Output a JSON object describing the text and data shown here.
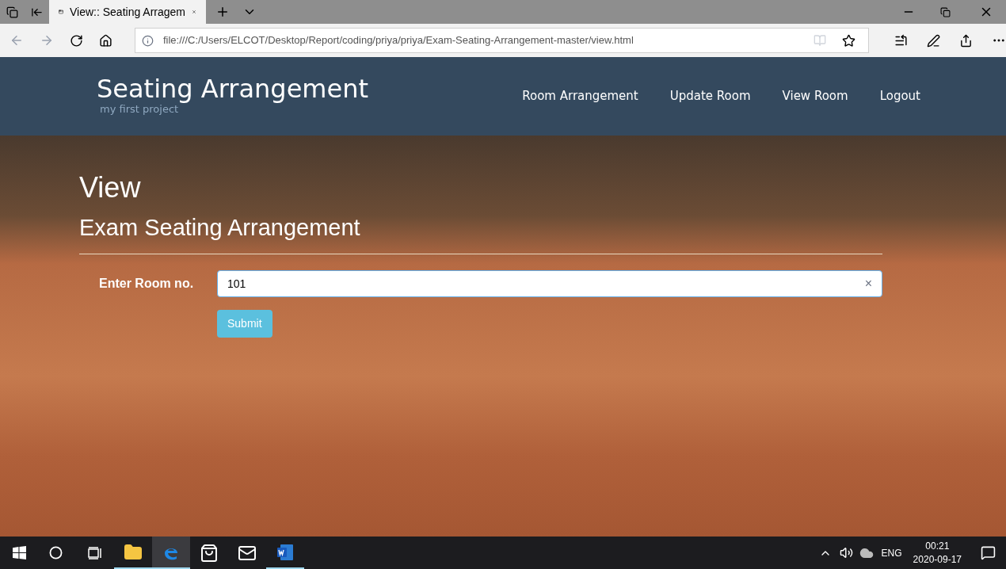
{
  "browser": {
    "tab_title": "View:: Seating Arragem",
    "url": "file:///C:/Users/ELCOT/Desktop/Report/coding/priya/priya/Exam-Seating-Arrangement-master/view.html"
  },
  "header": {
    "brand": "Seating Arrangement",
    "tagline": "my first project",
    "nav": [
      {
        "label": "Room Arrangement"
      },
      {
        "label": "Update Room"
      },
      {
        "label": "View Room"
      },
      {
        "label": "Logout"
      }
    ]
  },
  "page": {
    "title": "View",
    "subtitle": "Exam Seating Arrangement",
    "field_label": "Enter Room no.",
    "field_value": "101",
    "clear": "×",
    "submit": "Submit"
  },
  "taskbar": {
    "apps": [
      {
        "kind": "explorer",
        "running": true,
        "selected": false
      },
      {
        "kind": "edge",
        "running": true,
        "selected": true
      },
      {
        "kind": "store",
        "running": false,
        "selected": false
      },
      {
        "kind": "mail",
        "running": false,
        "selected": false
      },
      {
        "kind": "word",
        "running": true,
        "selected": false
      }
    ],
    "language": "ENG",
    "time": "00:21",
    "date": "2020-09-17"
  }
}
